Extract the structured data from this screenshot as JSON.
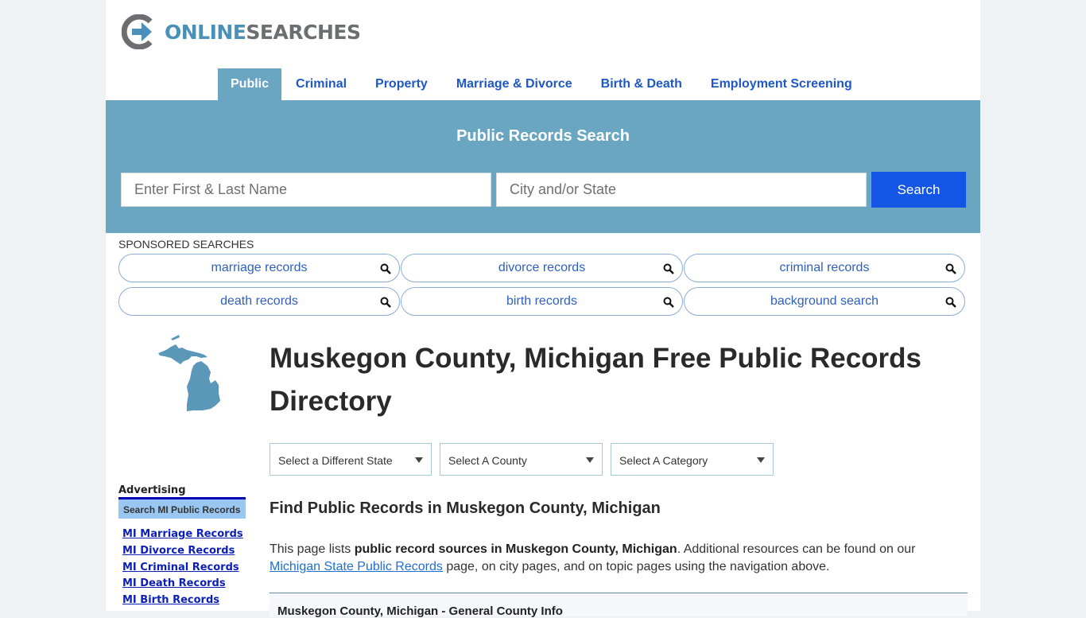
{
  "logo": {
    "part1": "ONLINE",
    "part2": "SEARCHES"
  },
  "nav": [
    {
      "label": "Public",
      "active": true
    },
    {
      "label": "Criminal",
      "active": false
    },
    {
      "label": "Property",
      "active": false
    },
    {
      "label": "Marriage & Divorce",
      "active": false
    },
    {
      "label": "Birth & Death",
      "active": false
    },
    {
      "label": "Employment Screening",
      "active": false
    }
  ],
  "search": {
    "title": "Public Records Search",
    "name_placeholder": "Enter First & Last Name",
    "name_value": "",
    "city_placeholder": "City and/or State",
    "city_value": "",
    "button": "Search"
  },
  "sponsored": {
    "label": "SPONSORED SEARCHES",
    "items": [
      "marriage records",
      "divorce records",
      "criminal records",
      "death records",
      "birth records",
      "background search"
    ]
  },
  "sidebar": {
    "map_icon": "michigan-state-map",
    "advertising_label": "Advertising",
    "box_label": "Search MI Public Records",
    "links": [
      "MI Marriage Records",
      "MI Divorce Records",
      "MI Criminal Records",
      "MI Death Records",
      "MI Birth Records"
    ]
  },
  "main": {
    "title": "Muskegon County, Michigan Free Public Records Directory",
    "selects": [
      {
        "selected": "Select a Different State"
      },
      {
        "selected": "Select A County"
      },
      {
        "selected": "Select A Category"
      }
    ],
    "subheading": "Find Public Records in Muskegon County, Michigan",
    "para_pre": "This page lists ",
    "para_bold": "public record sources in Muskegon County, Michigan",
    "para_mid": ". Additional resources can be found on our ",
    "para_link": "Michigan State Public Records",
    "para_post": " page, on city pages, and on topic pages using the navigation above.",
    "info_box_title": "Muskegon County, Michigan - General County Info"
  },
  "colors": {
    "brand_blue": "#6aa6c2",
    "button_blue": "#1356e6",
    "link_blue": "#1f57c3"
  }
}
